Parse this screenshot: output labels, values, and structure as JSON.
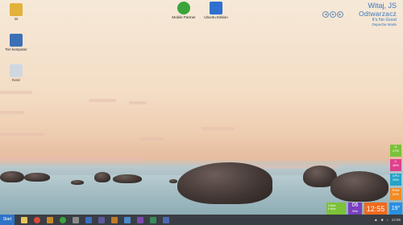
{
  "desktop_icons": [
    {
      "label": "M",
      "icon": "user-folder-icon",
      "color": "#e2b23a"
    },
    {
      "label": "Ten komputer",
      "icon": "computer-icon",
      "color": "#3b6fb6"
    },
    {
      "label": "Kosz",
      "icon": "recycle-bin-icon",
      "color": "#cfd8e0"
    },
    {
      "label": "Mobile Partner",
      "icon": "mobile-partner-icon",
      "color": "#3aa43a"
    },
    {
      "label": "Ubuntu Edition",
      "icon": "ubuntu-edition-icon",
      "color": "#2f6fd0"
    }
  ],
  "music_widget": {
    "greeting": "Witaj, JS",
    "app_name": "Odtwarzacz",
    "song": "It's No Good",
    "artist": "Depeche Mode",
    "controls": [
      "◀",
      "■",
      "▶"
    ]
  },
  "side_tiles": [
    {
      "letter": "D",
      "value": "47%",
      "color": "#7cc13a"
    },
    {
      "letter": "C",
      "value": "46%",
      "color": "#e0408c"
    },
    {
      "letter": "CPU",
      "value": "25%",
      "color": "#26a3c8"
    },
    {
      "letter": "RAM",
      "value": "52%",
      "color": "#f08a24"
    }
  ],
  "bottom_tiles": {
    "network": {
      "up": "0 kb/s",
      "down": "0 kb/s",
      "color": "#7cc13a"
    },
    "date": {
      "day": "06",
      "weekday": "Wto",
      "color": "#7a3fc0"
    },
    "clock": {
      "time": "12:55",
      "color": "#f06a1c"
    },
    "weather": {
      "temp": "19°",
      "color": "#2a8fe0"
    }
  },
  "taskbar": {
    "start_label": "Start",
    "apps": [
      {
        "icon": "file-explorer-icon",
        "color": "#e8c45a"
      },
      {
        "icon": "chrome-icon",
        "color": "#d94b3a"
      },
      {
        "icon": "winamp-icon",
        "color": "#c88a2a"
      },
      {
        "icon": "mobile-partner-icon",
        "color": "#3aa43a"
      },
      {
        "icon": "gadget-icon",
        "color": "#8a8a8a"
      },
      {
        "icon": "word-icon",
        "color": "#3a6fc0"
      },
      {
        "icon": "media-icon",
        "color": "#5a5a9a"
      },
      {
        "icon": "settings-icon",
        "color": "#c07a2a"
      },
      {
        "icon": "photo-icon",
        "color": "#4a8ad0"
      },
      {
        "icon": "dev-icon",
        "color": "#7a4ab0"
      },
      {
        "icon": "store-icon",
        "color": "#3a8a5a"
      },
      {
        "icon": "app-icon",
        "color": "#4a6ab0"
      }
    ],
    "tray_clock": "12:55"
  }
}
